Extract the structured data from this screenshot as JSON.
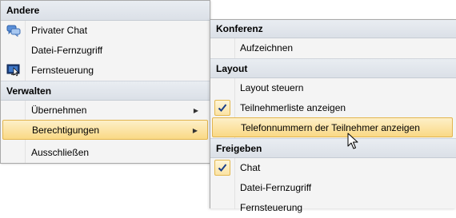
{
  "menu_left": {
    "groups": [
      {
        "header": "Andere",
        "items": [
          {
            "label": "Privater Chat",
            "icon": "chat-bubbles-icon"
          },
          {
            "label": "Datei-Fernzugriff"
          },
          {
            "label": "Fernsteuerung",
            "icon": "remote-control-icon"
          }
        ]
      },
      {
        "header": "Verwalten",
        "items": [
          {
            "label": "Übernehmen",
            "submenu": "arrow-right"
          },
          {
            "label": "Berechtigungen",
            "submenu": "arrow-right",
            "highlighted": true
          },
          {
            "label": "Ausschließen"
          }
        ]
      }
    ]
  },
  "menu_right": {
    "groups": [
      {
        "header": "Konferenz",
        "items": [
          {
            "label": "Aufzeichnen"
          }
        ]
      },
      {
        "header": "Layout",
        "items": [
          {
            "label": "Layout steuern"
          },
          {
            "label": "Teilnehmerliste anzeigen",
            "checked": true
          },
          {
            "label": "Telefonnummern der Teilnehmer anzeigen",
            "highlighted": true
          }
        ]
      },
      {
        "header": "Freigeben",
        "items": [
          {
            "label": "Chat",
            "checked": true
          },
          {
            "label": "Datei-Fernzugriff"
          },
          {
            "label": "Fernsteuerung"
          }
        ]
      }
    ]
  },
  "arrow_glyph": "▶",
  "colors": {
    "highlight": "#fad985",
    "highlight_border": "#e2b54e",
    "header_bg": "#e1e6ec"
  }
}
